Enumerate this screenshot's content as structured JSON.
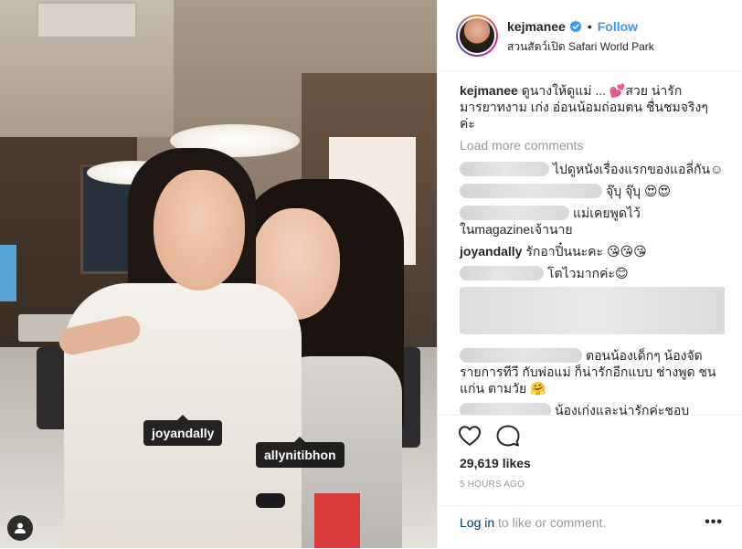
{
  "photo": {
    "tags": [
      "joyandally",
      "allynitibhon"
    ]
  },
  "header": {
    "username": "kejmanee",
    "follow_label": "Follow",
    "separator": "•",
    "location": "สวนสัตว์เปิด Safari World Park"
  },
  "comments": {
    "caption_user": "kejmanee",
    "caption_text": "ดูนางให้ดูแม่ ... 💕สวย น่ารัก มารยาทงาม เก่ง อ่อนน้อมถ่อมตน ชื่นชมจริงๆ ค่ะ",
    "load_more": "Load more comments",
    "items": [
      {
        "text": "ไปดูหนังเรื่องแรกของแอลี่กัน☺"
      },
      {
        "text": "จุ๊บุ จุ๊บุ 😍😍"
      },
      {
        "text": "แม่เคยพูดไว้ ในmagazineเจ้านาย"
      },
      {
        "user": "joyandally",
        "text": "รักอาปิ๋นนะคะ 😘😘😘"
      },
      {
        "text": "โตไวมากค่ะ😊"
      },
      {
        "text": "ตอนน้องเด็กๆ น้องจัดรายการทีวี กับพ่อแม่ ก็น่ารักอีกแบบ ช่างพูด ชนแก่น ตามวัย 🤗"
      },
      {
        "text": "น้องเก่งและน่ารักค่ะชอบ"
      }
    ]
  },
  "actions": {
    "likes": "29,619 likes",
    "time": "5 HOURS AGO",
    "login_link": "Log in",
    "login_rest": " to like or comment.",
    "more": "•••"
  },
  "colors": {
    "accent": "#3897f0",
    "link": "#003569",
    "muted": "#999999"
  },
  "icons": [
    "heart-icon",
    "comment-icon",
    "verified-badge-icon",
    "user-tag-icon",
    "more-options-icon"
  ]
}
